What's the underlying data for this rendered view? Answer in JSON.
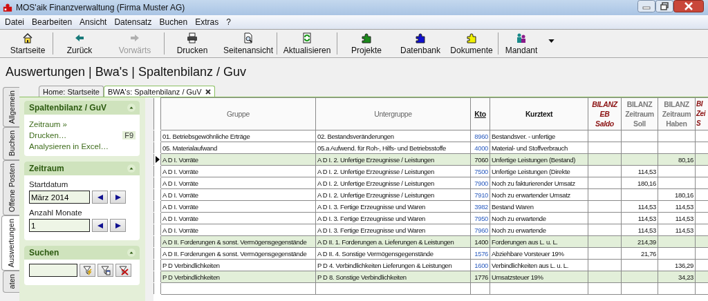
{
  "window": {
    "title": "MOS'aik Finanzverwaltung (Firma Muster AG)"
  },
  "menu": [
    "Datei",
    "Bearbeiten",
    "Ansicht",
    "Datensatz",
    "Buchen",
    "Extras",
    "?"
  ],
  "toolbar": [
    {
      "label": "Startseite",
      "disabled": false
    },
    {
      "label": "Zurück",
      "disabled": false
    },
    {
      "label": "Vorwärts",
      "disabled": true
    },
    {
      "label": "Drucken",
      "disabled": false
    },
    {
      "label": "Seitenansicht",
      "disabled": false
    },
    {
      "label": "Aktualisieren",
      "disabled": false
    },
    {
      "label": "Projekte",
      "disabled": false
    },
    {
      "label": "Datenbank",
      "disabled": false
    },
    {
      "label": "Dokumente",
      "disabled": false
    },
    {
      "label": "Mandant",
      "disabled": false
    }
  ],
  "heading": "Auswertungen | Bwa's | Spaltenbilanz / Guv",
  "side_tabs": [
    {
      "label": "Allgemein",
      "selected": false
    },
    {
      "label": "Buchen",
      "selected": false
    },
    {
      "label": "Offene Posten",
      "selected": false
    },
    {
      "label": "Auswertungen",
      "selected": true
    },
    {
      "label": "aten",
      "selected": false
    }
  ],
  "doc_tabs": [
    {
      "label": "Home: Startseite",
      "selected": false
    },
    {
      "label": "BWA's: Spaltenbilanz / GuV",
      "selected": true
    }
  ],
  "sidebar": {
    "actions_panel": {
      "title": "Spaltenbilanz / GuV",
      "items": [
        {
          "label": "Zeitraum »"
        },
        {
          "label": "Drucken…",
          "shortcut": "F9"
        },
        {
          "label": "Analysieren in Excel…"
        }
      ]
    },
    "period_panel": {
      "title": "Zeitraum",
      "fields": [
        {
          "label": "Startdatum",
          "value": "März 2014"
        },
        {
          "label": "Anzahl Monate",
          "value": "1"
        }
      ]
    },
    "search_panel": {
      "title": "Suchen"
    }
  },
  "table": {
    "columns": [
      {
        "lines": [
          "Gruppe"
        ],
        "kind": "plain"
      },
      {
        "lines": [
          "Untergruppe"
        ],
        "kind": "plain"
      },
      {
        "lines": [
          "Kto"
        ],
        "kind": "link"
      },
      {
        "lines": [
          "Kurztext"
        ],
        "kind": "bold"
      },
      {
        "lines": [
          "BILANZ",
          "EB",
          "Saldo"
        ],
        "kind": "eb"
      },
      {
        "lines": [
          "BILANZ",
          "Zeitraum",
          "Soll"
        ],
        "kind": "period"
      },
      {
        "lines": [
          "BILANZ",
          "Zeitraum",
          "Haben"
        ],
        "kind": "period"
      },
      {
        "lines": [
          "BI",
          "Zei",
          "S"
        ],
        "kind": "eb"
      }
    ],
    "rows": [
      {
        "current": false,
        "highlighted": false,
        "cells": [
          "01. Betriebsgewöhnliche Erträge",
          "02. Bestandsveränderungen",
          "8960",
          "Bestandsver. - unfertige",
          "",
          "",
          ""
        ]
      },
      {
        "current": false,
        "highlighted": false,
        "cells": [
          "05. Materialaufwand",
          "05.a Aufwend. für Roh-, Hilfs- und Betriebsstoffe",
          "4000",
          "Material- und Stoffverbrauch",
          "",
          "",
          ""
        ]
      },
      {
        "current": true,
        "highlighted": true,
        "cells": [
          "A D I. Vorräte",
          "A D I. 2. Unfertige Erzeugnisse / Leistungen",
          "7060",
          "Unfertige Leistungen (Bestand)",
          "",
          "",
          "80,16"
        ]
      },
      {
        "current": false,
        "highlighted": false,
        "cells": [
          "A D I. Vorräte",
          "A D I. 2. Unfertige Erzeugnisse / Leistungen",
          "7500",
          "Unfertige Leistungen (Direkte",
          "",
          "114,53",
          ""
        ]
      },
      {
        "current": false,
        "highlighted": false,
        "cells": [
          "A D I. Vorräte",
          "A D I. 2. Unfertige Erzeugnisse / Leistungen",
          "7900",
          "Noch zu fakturierender Umsatz",
          "",
          "180,16",
          ""
        ]
      },
      {
        "current": false,
        "highlighted": false,
        "cells": [
          "A D I. Vorräte",
          "A D I. 2. Unfertige Erzeugnisse / Leistungen",
          "7910",
          "Noch zu erwartender Umsatz",
          "",
          "",
          "180,16"
        ]
      },
      {
        "current": false,
        "highlighted": false,
        "cells": [
          "A D I. Vorräte",
          "A D I. 3. Fertige Erzeugnisse und Waren",
          "3982",
          "Bestand Waren",
          "",
          "114,53",
          "114,53"
        ]
      },
      {
        "current": false,
        "highlighted": false,
        "cells": [
          "A D I. Vorräte",
          "A D I. 3. Fertige Erzeugnisse und Waren",
          "7950",
          "Noch zu erwartende",
          "",
          "114,53",
          "114,53"
        ]
      },
      {
        "current": false,
        "highlighted": false,
        "cells": [
          "A D I. Vorräte",
          "A D I. 3. Fertige Erzeugnisse und Waren",
          "7960",
          "Noch zu erwartende",
          "",
          "114,53",
          "114,53"
        ]
      },
      {
        "current": false,
        "highlighted": true,
        "cells": [
          "A D II. Forderungen & sonst. Vermögensgegenstände",
          "A D II. 1. Forderungen a. Lieferungen & Leistungen",
          "1400",
          "Forderungen aus L. u. L.",
          "",
          "214,39",
          ""
        ]
      },
      {
        "current": false,
        "highlighted": false,
        "cells": [
          "A D II. Forderungen & sonst. Vermögensgegenstände",
          "A D II. 4. Sonstige Vermögensgegenstände",
          "1576",
          "Abziehbare Vorsteuer 19%",
          "",
          "21,76",
          ""
        ]
      },
      {
        "current": false,
        "highlighted": false,
        "cells": [
          "P D Verbindlichkeiten",
          "P D 4. Verbindlichkeiten Lieferungen & Leistungen",
          "1600",
          "Verbindlichkeiten aus L. u. L.",
          "",
          "",
          "136,29"
        ]
      },
      {
        "current": false,
        "highlighted": true,
        "cells": [
          "P D Verbindlichkeiten",
          "P D 8. Sonstige Verbindlichkeiten",
          "1776",
          "Umsatzsteuer 19%",
          "",
          "",
          "34,23"
        ]
      }
    ]
  }
}
